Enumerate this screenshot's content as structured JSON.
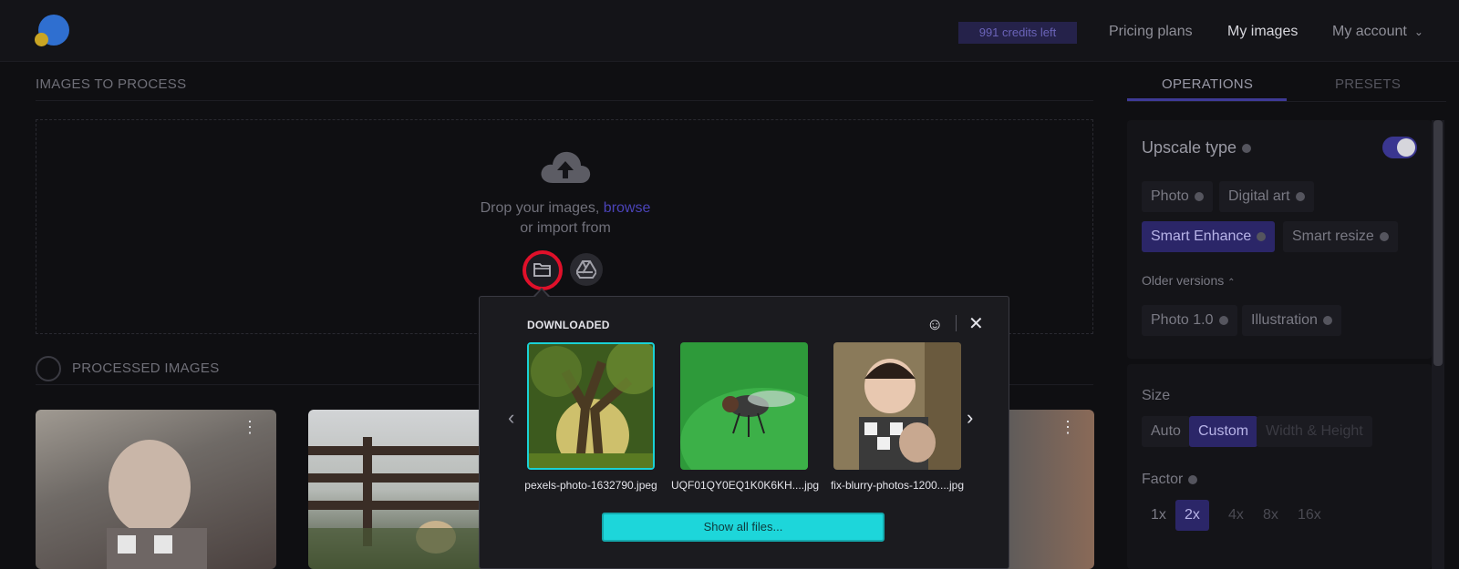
{
  "header": {
    "credits": "991 credits left",
    "nav": [
      "Pricing plans",
      "My images",
      "My account"
    ]
  },
  "main": {
    "images_to_process": "IMAGES TO PROCESS",
    "drop_text": "Drop your images,",
    "browse": "browse",
    "import_text": "or import from",
    "processed_images": "PROCESSED IMAGES"
  },
  "sidebar": {
    "tabs": [
      "OPERATIONS",
      "PRESETS"
    ],
    "upscale_type": "Upscale type",
    "types": [
      "Photo",
      "Digital art",
      "Smart Enhance",
      "Smart resize"
    ],
    "older_versions": "Older versions",
    "older": [
      "Photo 1.0",
      "Illustration"
    ],
    "size": "Size",
    "size_options": [
      "Auto",
      "Custom",
      "Width & Height"
    ],
    "factor": "Factor",
    "factors": [
      "1x",
      "2x",
      "4x",
      "8x",
      "16x"
    ]
  },
  "popup": {
    "title": "DOWNLOADED",
    "files": [
      "pexels-photo-1632790.jpeg",
      "UQF01QY0EQ1K0K6KH....jpg",
      "fix-blurry-photos-1200....jpg"
    ],
    "show_all": "Show all files..."
  },
  "colors": {
    "accent": "#2b2668",
    "selection": "#1ad2d6",
    "highlight": "#e0102a"
  }
}
